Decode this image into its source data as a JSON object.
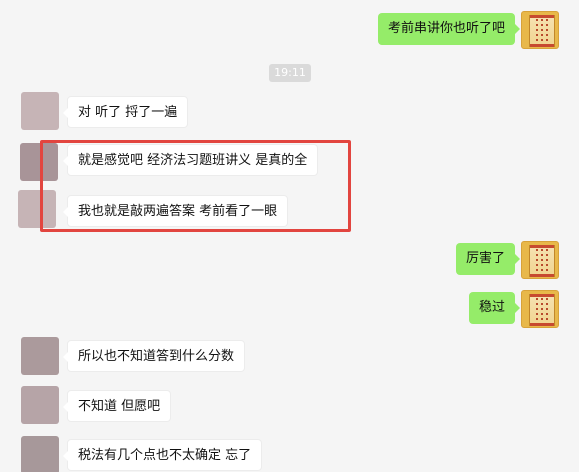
{
  "timestamp": "19:11",
  "messages": [
    {
      "side": "self",
      "text": "考前串讲你也听了吧"
    },
    {
      "side": "other",
      "text": "对 听了 捋了一遍"
    },
    {
      "side": "other",
      "text": "就是感觉吧 经济法习题班讲义 是真的全"
    },
    {
      "side": "other",
      "text": "我也就是敲两遍答案 考前看了一眼"
    },
    {
      "side": "self",
      "text": "厉害了"
    },
    {
      "side": "self",
      "text": "稳过"
    },
    {
      "side": "other",
      "text": "所以也不知道答到什么分数"
    },
    {
      "side": "other",
      "text": "不知道 但愿吧"
    },
    {
      "side": "other",
      "text": "税法有几个点也不太确定 忘了"
    }
  ],
  "colors": {
    "background": "#f5f5f5",
    "self_bubble": "#95ec69",
    "other_bubble": "#ffffff",
    "highlight": "#e2453f",
    "timestamp_bg": "#dadada"
  },
  "icons": {
    "self_avatar": "paper-scroll-avatar",
    "other_avatar": "blurred-avatar"
  }
}
